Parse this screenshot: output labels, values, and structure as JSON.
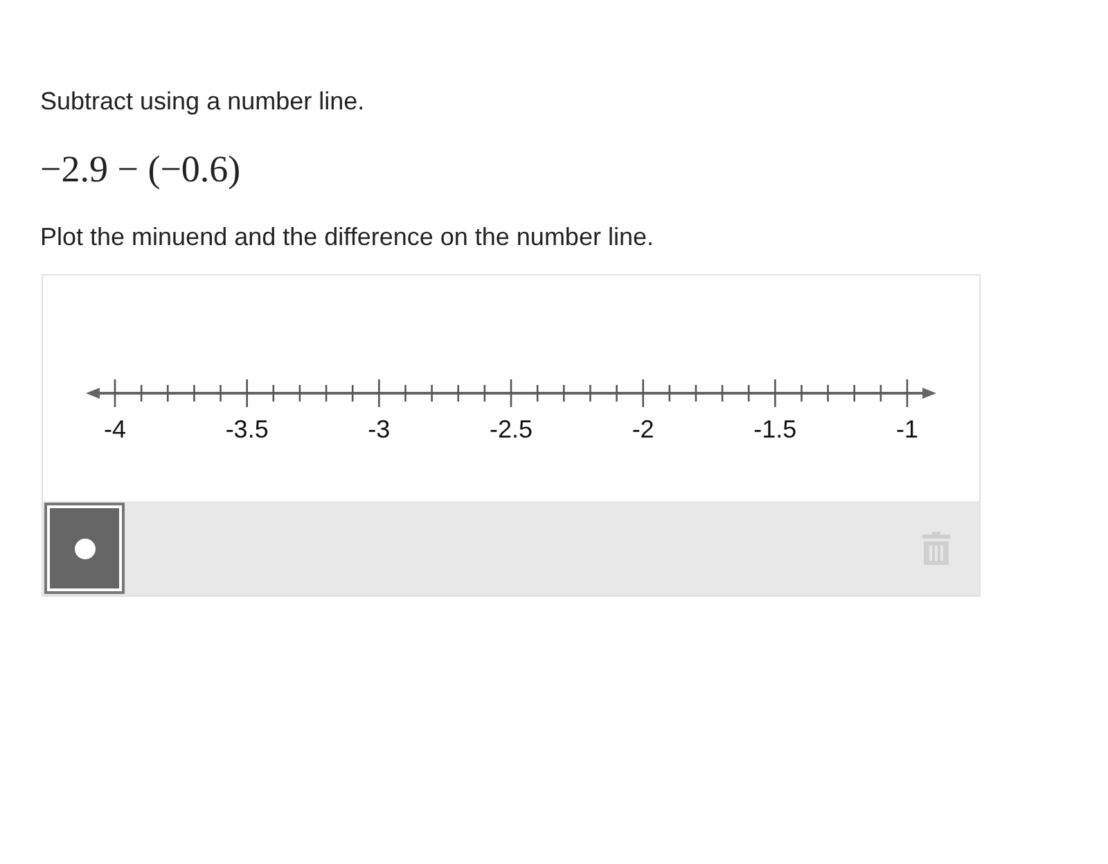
{
  "prompt": "Subtract using a number line.",
  "expression": "−2.9 − (−0.6)",
  "instruction": "Plot the minuend and the difference on the number line.",
  "number_line": {
    "labels": [
      "-4",
      "-3.5",
      "-3",
      "-2.5",
      "-2",
      "-1.5",
      "-1"
    ]
  },
  "tools": [
    {
      "kind": "point",
      "selected": true
    }
  ],
  "delete_button": {
    "disabled": true
  }
}
